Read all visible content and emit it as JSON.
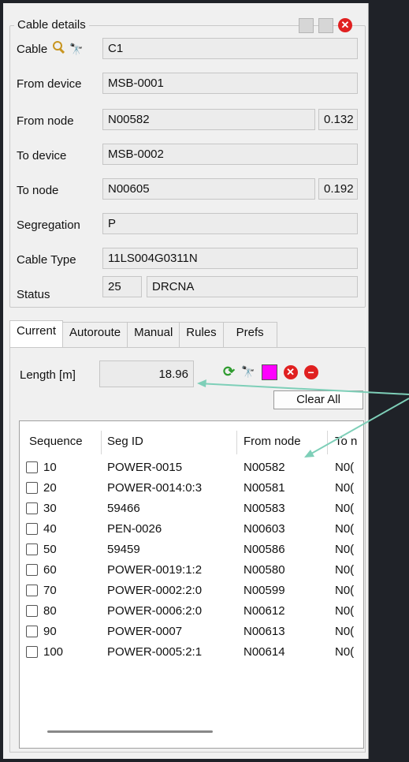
{
  "cable_details": {
    "title": "Cable details",
    "cable_label": "Cable",
    "cable_value": "C1",
    "from_device_label": "From device",
    "from_device_value": "MSB-0001",
    "from_node_label": "From node",
    "from_node_value": "N00582",
    "from_node_offset": "0.132",
    "to_device_label": "To device",
    "to_device_value": "MSB-0002",
    "to_node_label": "To node",
    "to_node_value": "N00605",
    "to_node_offset": "0.192",
    "segregation_label": "Segregation",
    "segregation_value": "P",
    "cable_type_label": "Cable Type",
    "cable_type_value": "11LS004G0311N",
    "status_label": "Status",
    "status_code": "25",
    "status_value": "DRCNA"
  },
  "tabs": [
    "Current",
    "Autoroute",
    "Manual",
    "Rules",
    "Prefs"
  ],
  "current": {
    "length_label": "Length [m]",
    "length_value": "18.96",
    "clear_all_label": "Clear All"
  },
  "table": {
    "headers": [
      "Sequence",
      "Seg ID",
      "From node",
      "To n"
    ],
    "rows": [
      {
        "seq": "10",
        "seg": "POWER-0015",
        "from": "N00582",
        "to": "N0("
      },
      {
        "seq": "20",
        "seg": "POWER-0014:0:3",
        "from": "N00581",
        "to": "N0("
      },
      {
        "seq": "30",
        "seg": "59466",
        "from": "N00583",
        "to": "N0("
      },
      {
        "seq": "40",
        "seg": "PEN-0026",
        "from": "N00603",
        "to": "N0("
      },
      {
        "seq": "50",
        "seg": "59459",
        "from": "N00586",
        "to": "N0("
      },
      {
        "seq": "60",
        "seg": "POWER-0019:1:2",
        "from": "N00580",
        "to": "N0("
      },
      {
        "seq": "70",
        "seg": "POWER-0002:2:0",
        "from": "N00599",
        "to": "N0("
      },
      {
        "seq": "80",
        "seg": "POWER-0006:2:0",
        "from": "N00612",
        "to": "N0("
      },
      {
        "seq": "90",
        "seg": "POWER-0007",
        "from": "N00613",
        "to": "N0("
      },
      {
        "seq": "100",
        "seg": "POWER-0005:2:1",
        "from": "N00614",
        "to": "N0("
      }
    ]
  },
  "colors": {
    "accent_magenta": "#ff00ff",
    "danger_red": "#e02020",
    "arrow_teal": "#7ecfb8"
  }
}
